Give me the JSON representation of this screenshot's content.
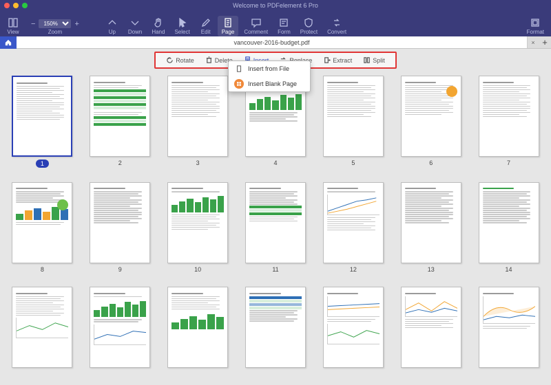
{
  "app_title": "Welcome to PDFelement 6 Pro",
  "toolbar": {
    "view": "View",
    "zoom": "Zoom",
    "zoom_value": "150%",
    "up": "Up",
    "down": "Down",
    "hand": "Hand",
    "select": "Select",
    "edit": "Edit",
    "page": "Page",
    "comment": "Comment",
    "form": "Form",
    "protect": "Protect",
    "convert": "Convert",
    "format": "Format"
  },
  "tab": {
    "filename": "vancouver-2016-budget.pdf"
  },
  "subtoolbar": {
    "rotate": "Rotate",
    "delete": "Delete",
    "insert": "Insert",
    "replace": "Replace",
    "extract": "Extract",
    "split": "Split"
  },
  "dropdown": {
    "from_file": "Insert from File",
    "blank": "Insert Blank Page"
  },
  "pages": [
    "1",
    "2",
    "3",
    "4",
    "5",
    "6",
    "7",
    "8",
    "9",
    "10",
    "11",
    "12",
    "13",
    "14"
  ],
  "selected_page": 1
}
